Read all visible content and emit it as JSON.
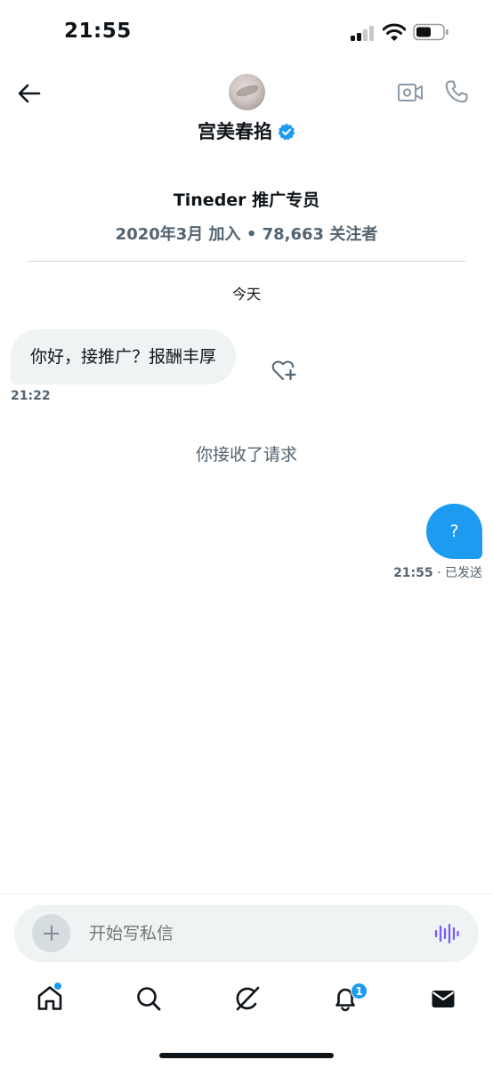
{
  "status_bar": {
    "time": "21:55"
  },
  "header": {
    "name": "宫美春掐",
    "icons": [
      "back-arrow-icon",
      "verified-badge-icon",
      "video-call-icon",
      "phone-icon"
    ]
  },
  "profile": {
    "bio": "Tineder 推广专员",
    "meta": "2020年3月 加入 • 78,663 关注者"
  },
  "conversation": {
    "date_label": "今天",
    "incoming": {
      "text": "你好，接推广？报酬丰厚",
      "time": "21:22"
    },
    "accept_note": "你接收了请求",
    "outgoing": {
      "text": "?",
      "time": "21:55",
      "status": " · 已发送"
    }
  },
  "composer": {
    "placeholder": "开始写私信"
  },
  "tab_bar": {
    "items": [
      "home",
      "search",
      "grok",
      "notifications",
      "messages"
    ],
    "notifications_badge": "1"
  },
  "colors": {
    "accent": "#1d9bf0",
    "secondary_text": "#536471",
    "bubble_in": "#eff3f4",
    "voice_icon": "#7856ff"
  }
}
